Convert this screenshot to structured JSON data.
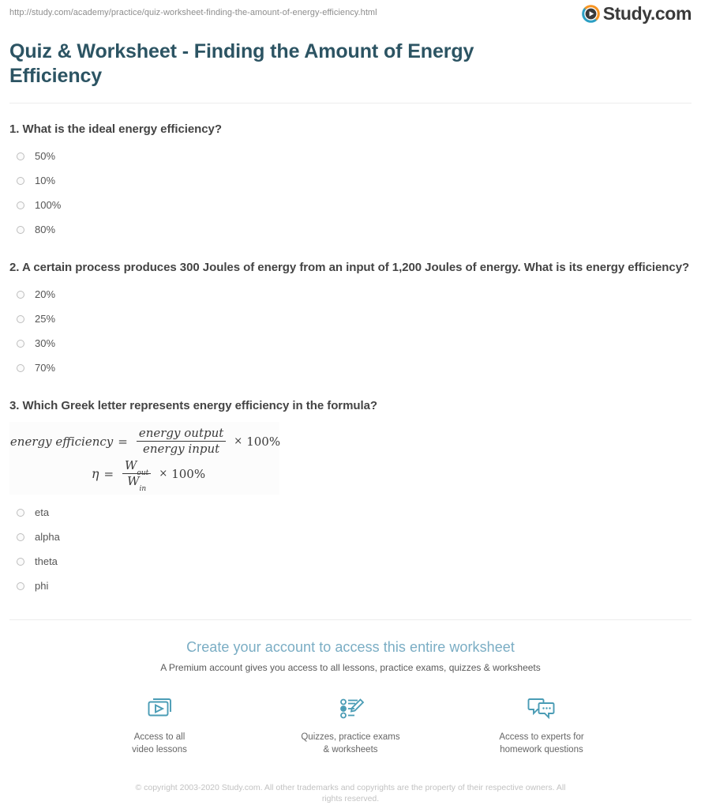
{
  "header": {
    "url": "http://study.com/academy/practice/quiz-worksheet-finding-the-amount-of-energy-efficiency.html",
    "logo_text": "Study.com",
    "logo_icon": "play-circle-icon",
    "logo_colors": {
      "orange": "#f79421",
      "teal": "#2b9fc4",
      "text": "#3a3a3a"
    }
  },
  "page_title": "Quiz & Worksheet - Finding the Amount of Energy Efficiency",
  "theme": {
    "title_color": "#2c5463",
    "cta_color": "#7aadc4",
    "icon_color": "#4a9cb5",
    "question_color": "#444444",
    "option_color": "#555555"
  },
  "questions": [
    {
      "number": "1.",
      "text": "1. What is the ideal energy efficiency?",
      "options": [
        {
          "label": "50%"
        },
        {
          "label": "10%"
        },
        {
          "label": "100%"
        },
        {
          "label": "80%"
        }
      ]
    },
    {
      "number": "2.",
      "text": "2. A certain process produces 300 Joules of energy from an input of 1,200 Joules of energy. What is its energy efficiency?",
      "options": [
        {
          "label": "20%"
        },
        {
          "label": "25%"
        },
        {
          "label": "30%"
        },
        {
          "label": "70%"
        }
      ]
    },
    {
      "number": "3.",
      "text": "3. Which Greek letter represents energy efficiency in the formula?",
      "formula": {
        "line1": {
          "lhs": "energy efficiency",
          "equals": "=",
          "numerator": "energy output",
          "denominator": "energy input",
          "times": "×",
          "rhs": "100%"
        },
        "line2": {
          "lhs": "η",
          "equals": "=",
          "numerator_base": "W",
          "numerator_sub": "out",
          "denominator_base": "W",
          "denominator_sub": "in",
          "times": "×",
          "rhs": "100%"
        }
      },
      "options": [
        {
          "label": "eta"
        },
        {
          "label": "alpha"
        },
        {
          "label": "theta"
        },
        {
          "label": "phi"
        }
      ]
    }
  ],
  "cta": {
    "title": "Create your account to access this entire worksheet",
    "subtitle": "A Premium account gives you access to all lessons, practice exams, quizzes & worksheets",
    "features": [
      {
        "icon": "video-stack-icon",
        "line1": "Access to all",
        "line2": "video lessons"
      },
      {
        "icon": "quiz-pencil-icon",
        "line1": "Quizzes, practice exams",
        "line2": "& worksheets"
      },
      {
        "icon": "chat-bubbles-icon",
        "line1": "Access to experts for",
        "line2": "homework questions"
      }
    ]
  },
  "copyright": "© copyright 2003-2020 Study.com. All other trademarks and copyrights are the property of their respective owners. All rights reserved."
}
